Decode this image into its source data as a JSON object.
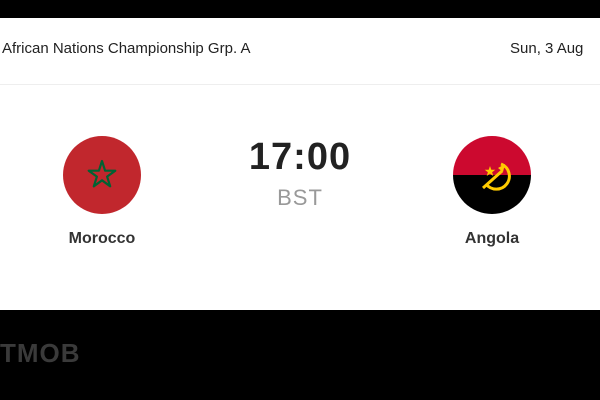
{
  "header": {
    "competition": "African Nations Championship Grp. A",
    "date": "Sun, 3 Aug"
  },
  "match": {
    "home_team": {
      "name": "Morocco",
      "flag_icon": "morocco-flag-icon",
      "colors": {
        "field": "#c1272d",
        "star": "#006233"
      }
    },
    "away_team": {
      "name": "Angola",
      "flag_icon": "angola-flag-icon",
      "colors": {
        "top": "#cc092f",
        "bottom": "#000000",
        "emblem": "#ffcb00"
      }
    },
    "kickoff_time": "17:00",
    "timezone": "BST"
  },
  "watermark": "TMOB",
  "colors": {
    "background": "#000000",
    "card": "#ffffff",
    "text": "#222222",
    "muted": "#999999"
  }
}
